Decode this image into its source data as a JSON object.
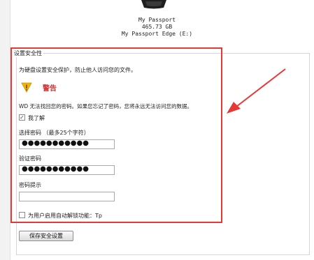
{
  "device": {
    "name": "My Passport",
    "capacity": "465.73 GB",
    "volume": "My Passport Edge (E:)"
  },
  "security": {
    "section_title": "设置安全性",
    "description": "为硬盘设置安全保护，防止他人访问您的文件。",
    "warning_title": "警告",
    "warning_text": "WD 无法找回您的密码。如果您忘记了密码，您将永远无法访问您的数据。",
    "understand_label": "我了解",
    "understand_checked": true,
    "password_label": "选择密码 （最多25个字符）",
    "password_value": "●●●●●●●●●●●",
    "verify_label": "验证密码",
    "verify_value": "●●●●●●●●●●●",
    "hint_label": "密码提示",
    "hint_value": "",
    "autounlock_label": "为用户启用自动解锁功能：Tp",
    "autounlock_checked": false,
    "save_button": "保存安全设置"
  },
  "colors": {
    "highlight": "#e53935",
    "warning_text": "#d32f2f",
    "warning_icon": "#f4b400"
  }
}
